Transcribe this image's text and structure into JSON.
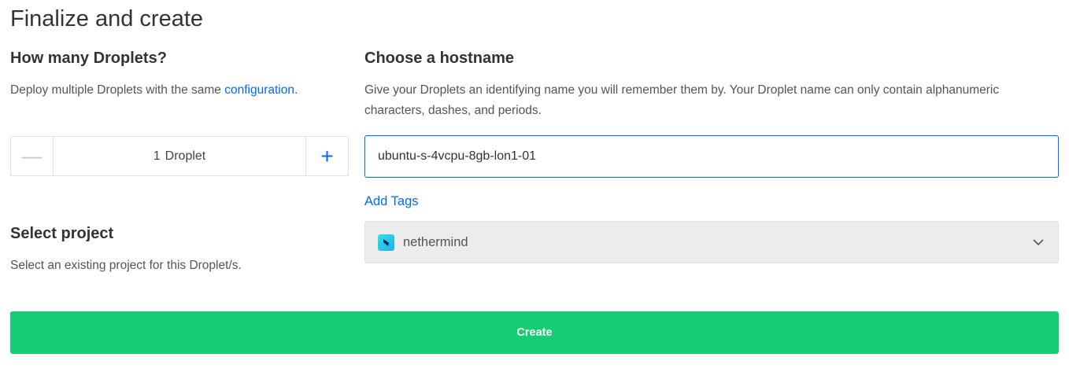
{
  "page": {
    "title": "Finalize and create"
  },
  "droplets": {
    "heading": "How many Droplets?",
    "description_prefix": "Deploy multiple Droplets with the same ",
    "description_link": "configuration",
    "description_suffix": ".",
    "stepper": {
      "minus_symbol": "—",
      "count": "1",
      "unit": "Droplet",
      "plus_symbol": "+"
    }
  },
  "hostname": {
    "heading": "Choose a hostname",
    "description": "Give your Droplets an identifying name you will remember them by. Your Droplet name can only contain alphanumeric characters, dashes, and periods.",
    "value": "ubuntu-s-4vcpu-8gb-lon1-01",
    "add_tags_label": "Add Tags"
  },
  "project": {
    "heading": "Select project",
    "description": "Select an existing project for this Droplet/s.",
    "selected": "nethermind"
  },
  "actions": {
    "create_label": "Create"
  },
  "colors": {
    "accent": "#0069ff",
    "create": "#15cd72",
    "project_logo": "#1fb0e6"
  },
  "icons": {
    "project": "nethermind-logo-icon",
    "dropdown": "chevron-down-icon"
  }
}
